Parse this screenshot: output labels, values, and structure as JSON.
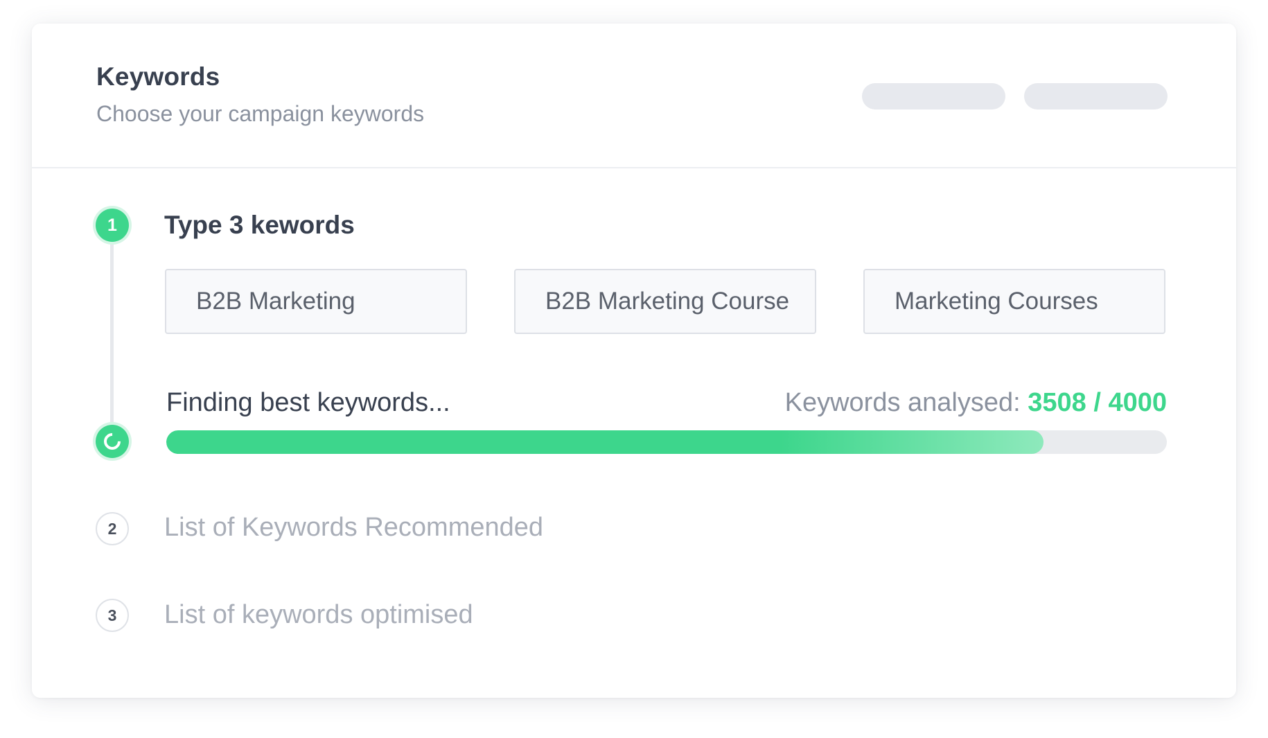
{
  "header": {
    "title": "Keywords",
    "subtitle": "Choose your campaign keywords"
  },
  "steps": [
    {
      "number": "1",
      "title": "Type 3 kewords",
      "status": "active",
      "keywords": [
        "B2B Marketing",
        "B2B Marketing Course",
        "Marketing Courses"
      ]
    },
    {
      "number": "2",
      "title": "List of Keywords Recommended",
      "status": "pending"
    },
    {
      "number": "3",
      "title": "List of keywords optimised",
      "status": "pending"
    }
  ],
  "progress": {
    "label": "Finding best keywords...",
    "analysed_label": "Keywords analysed:",
    "analysed_count": "3508 / 4000",
    "fraction": 0.877
  },
  "colors": {
    "accent": "#3dd68c",
    "text_dark": "#38404f",
    "text_muted": "#8a919e",
    "text_disabled": "#a9aeb8"
  }
}
